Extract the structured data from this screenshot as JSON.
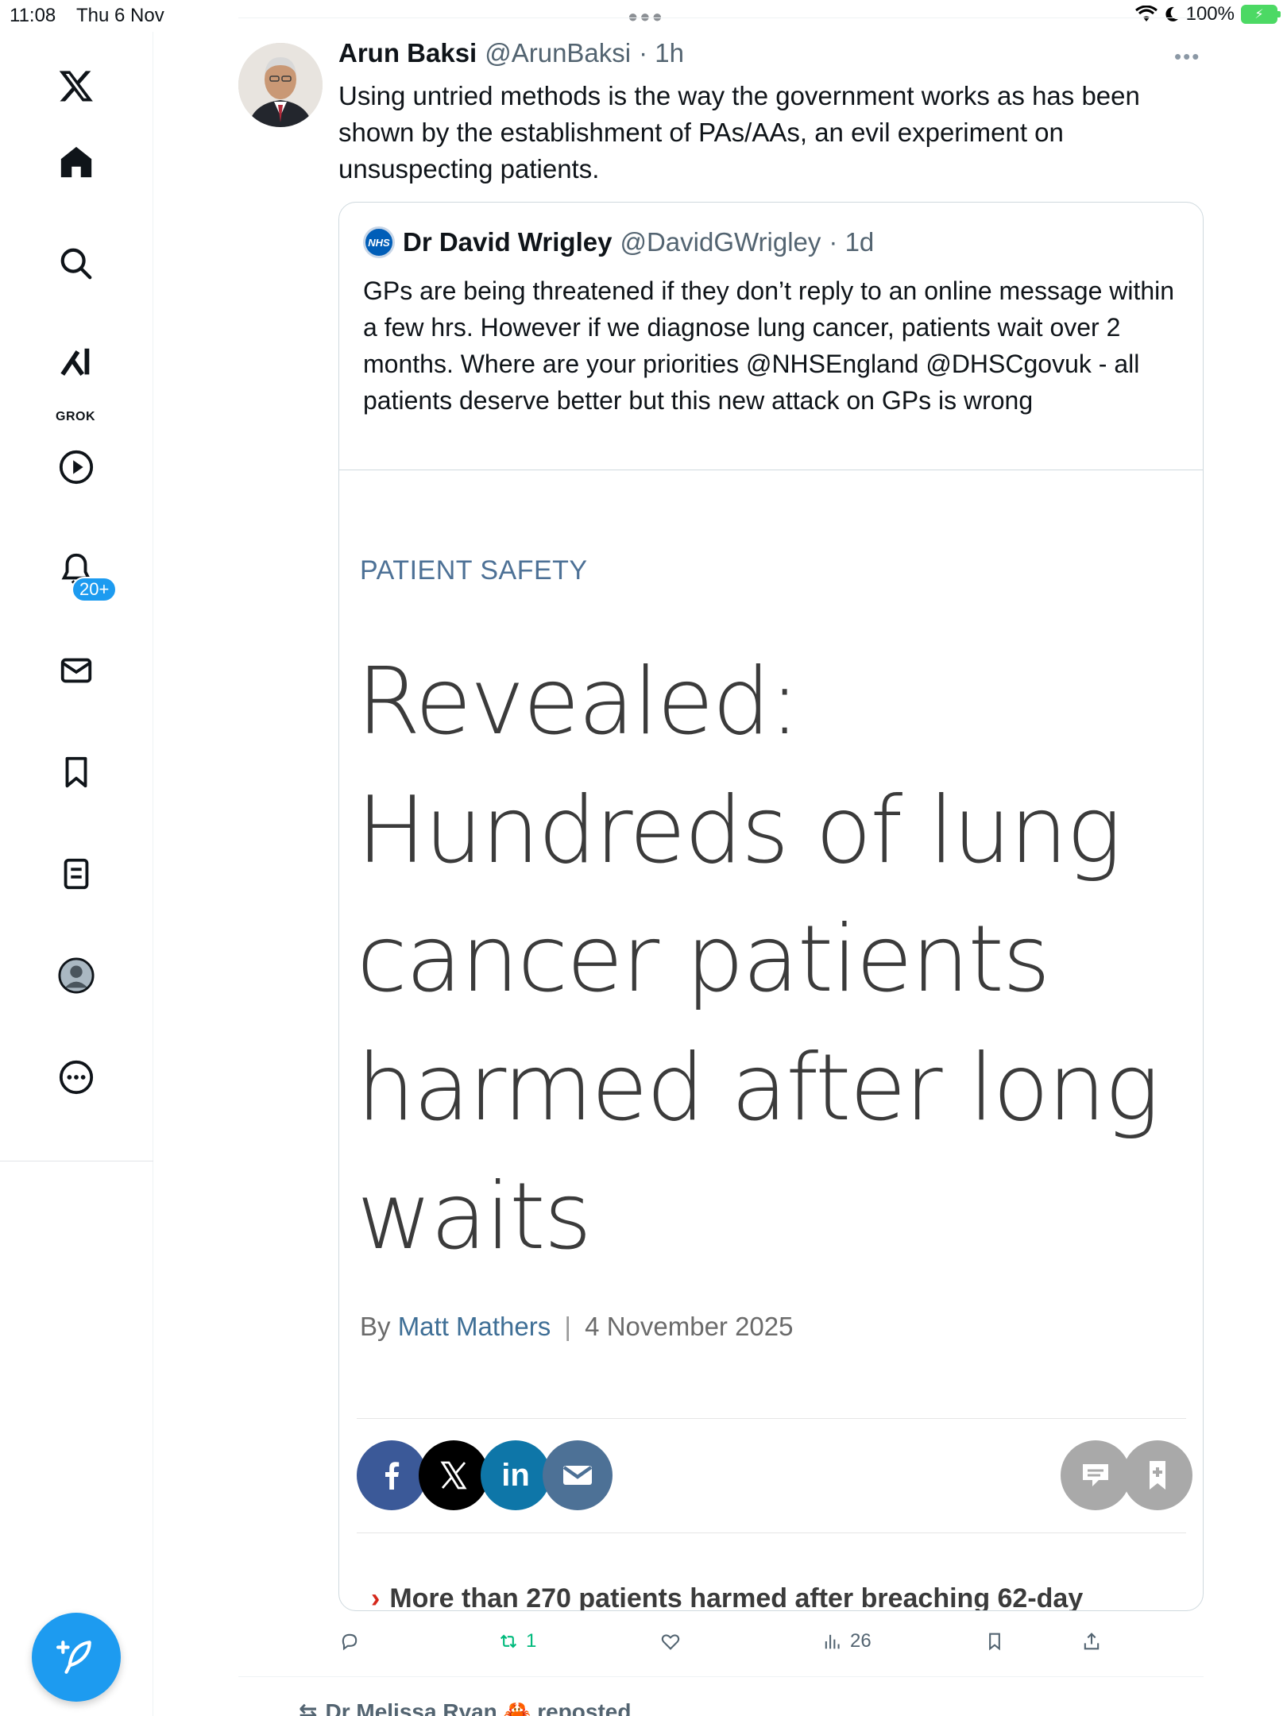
{
  "status_bar": {
    "time": "11:08",
    "date": "Thu 6 Nov",
    "battery": "100%"
  },
  "sidebar": {
    "grok_label": "GROK",
    "notifications_badge": "20+"
  },
  "tweet": {
    "author_name": "Arun Baksi",
    "author_handle": "@ArunBaksi",
    "time": "· 1h",
    "text": "Using untried methods is the way the government works as has been shown by the establishment of PAs/AAs, an evil experiment on unsuspecting patients."
  },
  "quote": {
    "author_name": "Dr David Wrigley",
    "author_handle": "@DavidGWrigley",
    "time": "· 1d",
    "logo_text": "NHS",
    "text": "GPs are being threatened if they don’t reply to an online message within a few hrs. However if we diagnose lung cancer, patients wait over 2 months. Where are your priorities @NHSEngland @DHSCgovuk - all patients deserve better but this new attack on GPs is wrong"
  },
  "article": {
    "category": "PATIENT SAFETY",
    "headline": "Revealed: Hundreds of lung cancer patients harmed after long waits",
    "byline_prefix": "By",
    "byline_author": "Matt Mathers",
    "byline_sep": "|",
    "date": "4 November 2025",
    "teaser": "More than 270 patients harmed after breaching 62-day"
  },
  "actions": {
    "reposts": "1",
    "views": "26"
  },
  "next_item": {
    "repost_note": "Dr Melissa Ryan 🦀 reposted"
  },
  "colors": {
    "accent": "#1d9bf0",
    "repost_green": "#00ba7c",
    "facebook": "#3b5998",
    "twitter_x": "#000000",
    "linkedin": "#0e76a8",
    "email": "#4d7196",
    "grey_btn": "#a9a9a9"
  }
}
